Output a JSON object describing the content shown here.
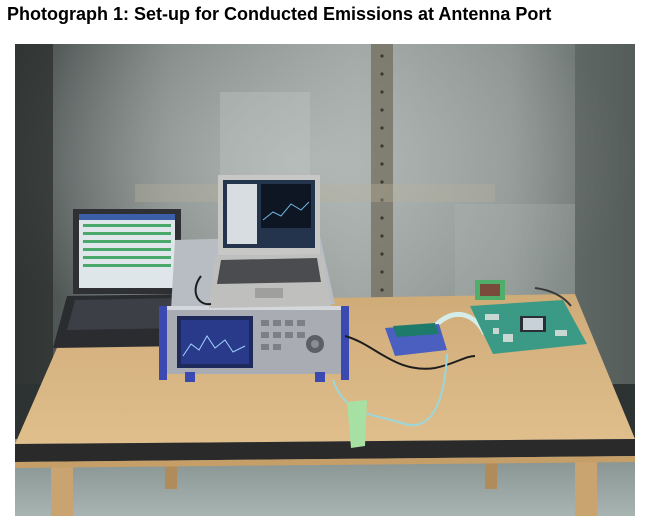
{
  "caption": {
    "text": "Photograph 1: Set-up for Conducted Emissions at Antenna Port"
  },
  "photo": {
    "scene": "test-setup-photograph",
    "colors": {
      "wall": "#8e9593",
      "table_top": "#d5b27e",
      "table_edge": "#2a2a2a",
      "analyzer_body": "#a9acb2",
      "analyzer_screen": "#2a3a8a",
      "laptop_silver": "#c7c8c6",
      "laptop_dark": "#2e3034",
      "pcb_green": "#3a9a85",
      "dongle_blue": "#4a5fc0",
      "cable_cyan": "#9ad7dc"
    }
  }
}
